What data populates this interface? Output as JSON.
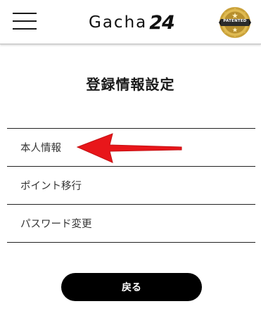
{
  "header": {
    "logo_text": "Gacha",
    "logo_number": "24",
    "badge_text": "PATENTED",
    "menu_icon": "hamburger-icon"
  },
  "main": {
    "title": "登録情報設定",
    "items": [
      {
        "label": "本人情報"
      },
      {
        "label": "ポイント移行"
      },
      {
        "label": "パスワード変更"
      }
    ],
    "back_label": "戻る"
  },
  "annotation": {
    "arrow_color": "#e8161a",
    "points_to": "本人情報"
  },
  "colors": {
    "button_bg": "#000000",
    "button_text": "#ffffff",
    "badge_gold": "#c9a13a",
    "badge_dark": "#2b2b2b"
  }
}
